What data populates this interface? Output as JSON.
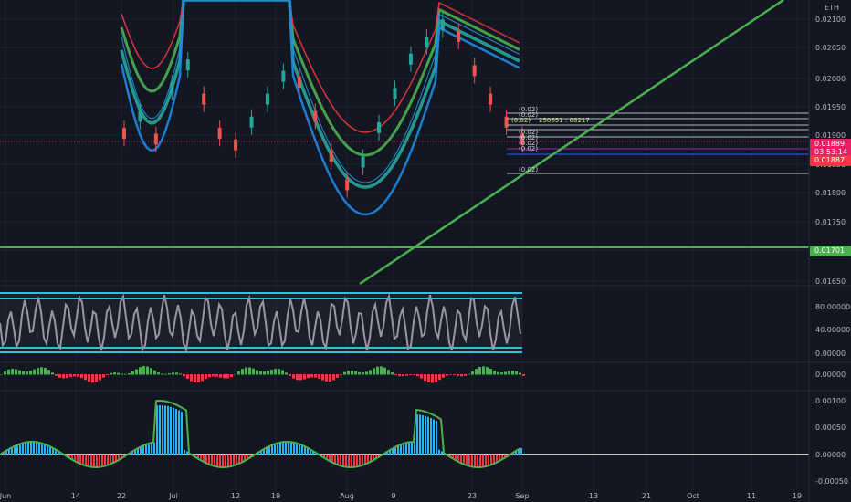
{
  "header": {
    "currency": "ETH"
  },
  "colors": {
    "background": "#131722",
    "grid": "#1e222d",
    "axis_text": "#b2b5be",
    "green_line": "#4caf50",
    "price_badge": "#e91e63",
    "stop_badge": "#f23645",
    "support_badge": "#4caf50",
    "cyan": "#26c6da",
    "red": "#f23645",
    "blue": "#2196f3"
  },
  "chart_data": [
    {
      "type": "line",
      "name": "price-panel",
      "y_ticks": [
        "0.02100",
        "0.02050",
        "0.02000",
        "0.01950",
        "0.01900",
        "0.01850",
        "0.01800",
        "0.01750",
        "0.01700",
        "0.01650"
      ],
      "ylim": [
        0.0163,
        0.0214
      ],
      "price_labels": [
        {
          "kind": "last",
          "value": "0.01889",
          "sub": "03:53:14"
        },
        {
          "kind": "level",
          "value": "0.01887"
        },
        {
          "kind": "support",
          "value": "0.01701"
        }
      ],
      "annotations": [
        "(0.02)",
        "(0.02)",
        "(0.02)",
        "258651 : 86217",
        "(0.02)",
        "(0.02)",
        "(0.02)",
        "(0.02)",
        "(0.02)"
      ],
      "horizontal_level": 0.01701,
      "trendline": {
        "from": [
          "2021-08-02",
          0.01658
        ],
        "to": [
          "2021-10-23",
          0.02145
        ]
      },
      "series": [
        {
          "values": [
            0.019,
            0.0193,
            0.0189,
            0.0198,
            0.0202,
            0.0196,
            0.019,
            0.0188,
            0.0192,
            0.0196,
            0.02,
            0.0199,
            0.0193,
            0.0186,
            0.0181,
            0.0185,
            0.0191,
            0.0197,
            0.0203,
            0.0206,
            0.0209,
            0.0207,
            0.0201,
            0.0196,
            0.0192,
            0.0189
          ]
        }
      ]
    },
    {
      "type": "line",
      "name": "oscillator-1",
      "y_ticks": [
        "80.00000",
        "40.00000",
        "0.00000"
      ],
      "ylim": [
        -5,
        105
      ],
      "bands": [
        100,
        90,
        5,
        0
      ]
    },
    {
      "type": "bar",
      "name": "oscillator-2",
      "y_ticks": [
        "0.00000"
      ]
    },
    {
      "type": "bar",
      "name": "oscillator-3",
      "y_ticks": [
        "0.00100",
        "0.00050",
        "0.00000",
        "-0.00050"
      ],
      "ylim": [
        -0.00065,
        0.00115
      ],
      "zero_line": 0
    }
  ],
  "x_axis": {
    "ticks": [
      "Jun",
      "14",
      "22",
      "Jul",
      "12",
      "19",
      "Aug",
      "9",
      "23",
      "Sep",
      "13",
      "21",
      "Oct",
      "11",
      "19"
    ]
  }
}
